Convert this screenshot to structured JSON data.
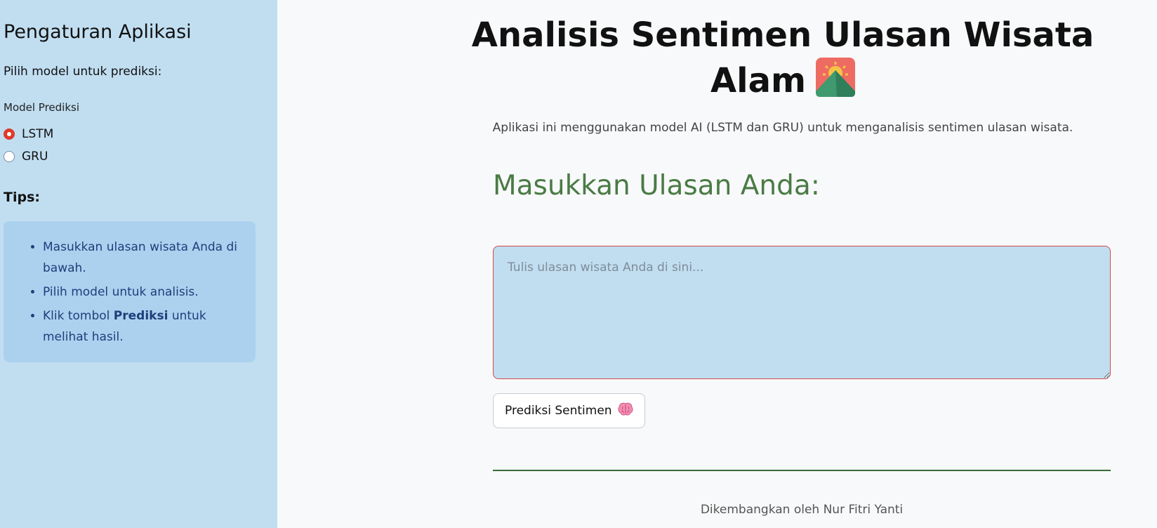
{
  "sidebar": {
    "title": "Pengaturan Aplikasi",
    "subtitle": "Pilih model untuk prediksi:",
    "radio_label": "Model Prediksi",
    "options": [
      {
        "label": "LSTM",
        "selected": true
      },
      {
        "label": "GRU",
        "selected": false
      }
    ],
    "tips_heading": "Tips:",
    "tips": {
      "item1": "Masukkan ulasan wisata Anda di bawah.",
      "item2": "Pilih model untuk analisis.",
      "item3_prefix": "Klik tombol ",
      "item3_bold": "Prediksi",
      "item3_suffix": " untuk melihat hasil."
    }
  },
  "main": {
    "title": "Analisis Sentimen Ulasan Wisata Alam",
    "title_icon": "sunrise-over-mountains-icon",
    "subtitle": "Aplikasi ini menggunakan model AI (LSTM dan GRU) untuk menganalisis sentimen ulasan wisata.",
    "section_heading": "Masukkan Ulasan Anda:",
    "review_input": {
      "value": "",
      "placeholder": "Tulis ulasan wisata Anda di sini..."
    },
    "predict_button_label": "Prediksi Sentimen",
    "predict_button_icon": "brain-icon",
    "footer": "Dikembangkan oleh Nur Fitri Yanti"
  },
  "colors": {
    "sidebar_bg": "#c1def1",
    "tips_bg": "#acd1ef",
    "radio_accent": "#e0392b",
    "section_heading": "#4a7b45",
    "divider": "#3a6a38"
  }
}
